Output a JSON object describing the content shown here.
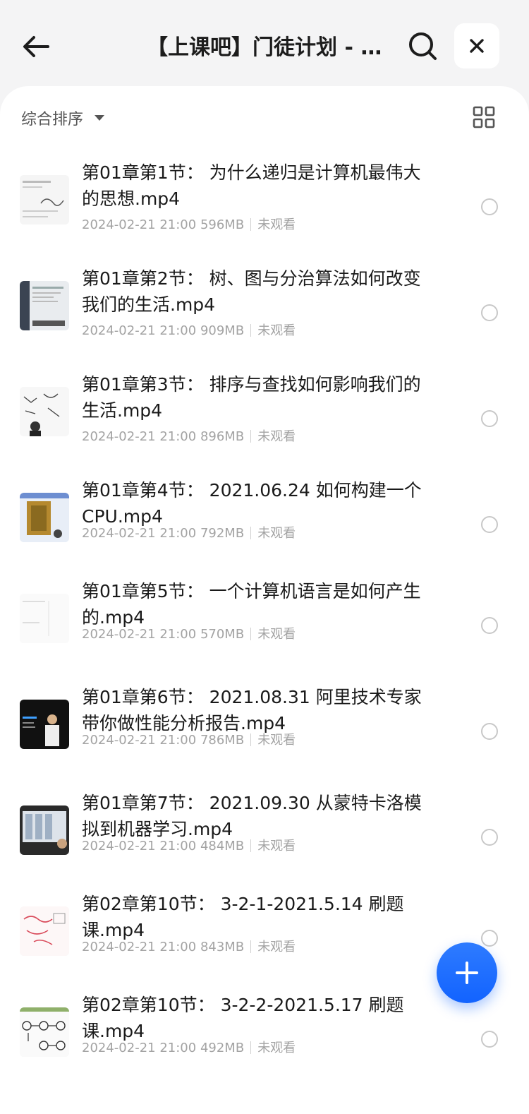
{
  "header": {
    "title": "【上课吧】门徒计划 - A...",
    "back_icon": "arrow-left-icon",
    "search_icon": "search-icon",
    "close_icon": "close-icon"
  },
  "toolbar": {
    "sort_label": "综合排序",
    "sort_icon": "caret-down-icon",
    "view_icon": "grid-view-icon"
  },
  "files": [
    {
      "title": "第01章第1节： 为什么递归是计算机最伟大的思想.mp4",
      "date": "2024-02-21 21:00",
      "size": "596MB",
      "status": "未观看",
      "thumb": "light"
    },
    {
      "title": "第01章第2节： 树、图与分治算法如何改变我们的生活.mp4",
      "date": "2024-02-21 21:00",
      "size": "909MB",
      "status": "未观看",
      "thumb": "screen"
    },
    {
      "title": "第01章第3节： 排序与查找如何影响我们的生活.mp4",
      "date": "2024-02-21 21:00",
      "size": "896MB",
      "status": "未观看",
      "thumb": "sketch"
    },
    {
      "title": "第01章第4节： 2021.06.24 如何构建一个CPU.mp4",
      "date": "2024-02-21 21:00",
      "size": "792MB",
      "status": "未观看",
      "thumb": "chip"
    },
    {
      "title": "第01章第5节： 一个计算机语言是如何产生的.mp4",
      "date": "2024-02-21 21:00",
      "size": "570MB",
      "status": "未观看",
      "thumb": "blank"
    },
    {
      "title": "第01章第6节： 2021.08.31 阿里技术专家带你做性能分析报告.mp4",
      "date": "2024-02-21 21:00",
      "size": "786MB",
      "status": "未观看",
      "thumb": "dark"
    },
    {
      "title": "第01章第7节： 2021.09.30 从蒙特卡洛模拟到机器学习.mp4",
      "date": "2024-02-21 21:00",
      "size": "484MB",
      "status": "未观看",
      "thumb": "screen2"
    },
    {
      "title": "第02章第10节： 3-2-1-2021.5.14 刷题课.mp4",
      "date": "2024-02-21 21:00",
      "size": "843MB",
      "status": "未观看",
      "thumb": "pink"
    },
    {
      "title": "第02章第10节： 3-2-2-2021.5.17 刷题课.mp4",
      "date": "2024-02-21 21:00",
      "size": "492MB",
      "status": "未观看",
      "thumb": "nodes"
    }
  ],
  "fab": {
    "icon": "plus-icon"
  },
  "colors": {
    "accent": "#1263ff",
    "title_text": "#1a1a1a",
    "meta_text": "#a3a3a3"
  }
}
